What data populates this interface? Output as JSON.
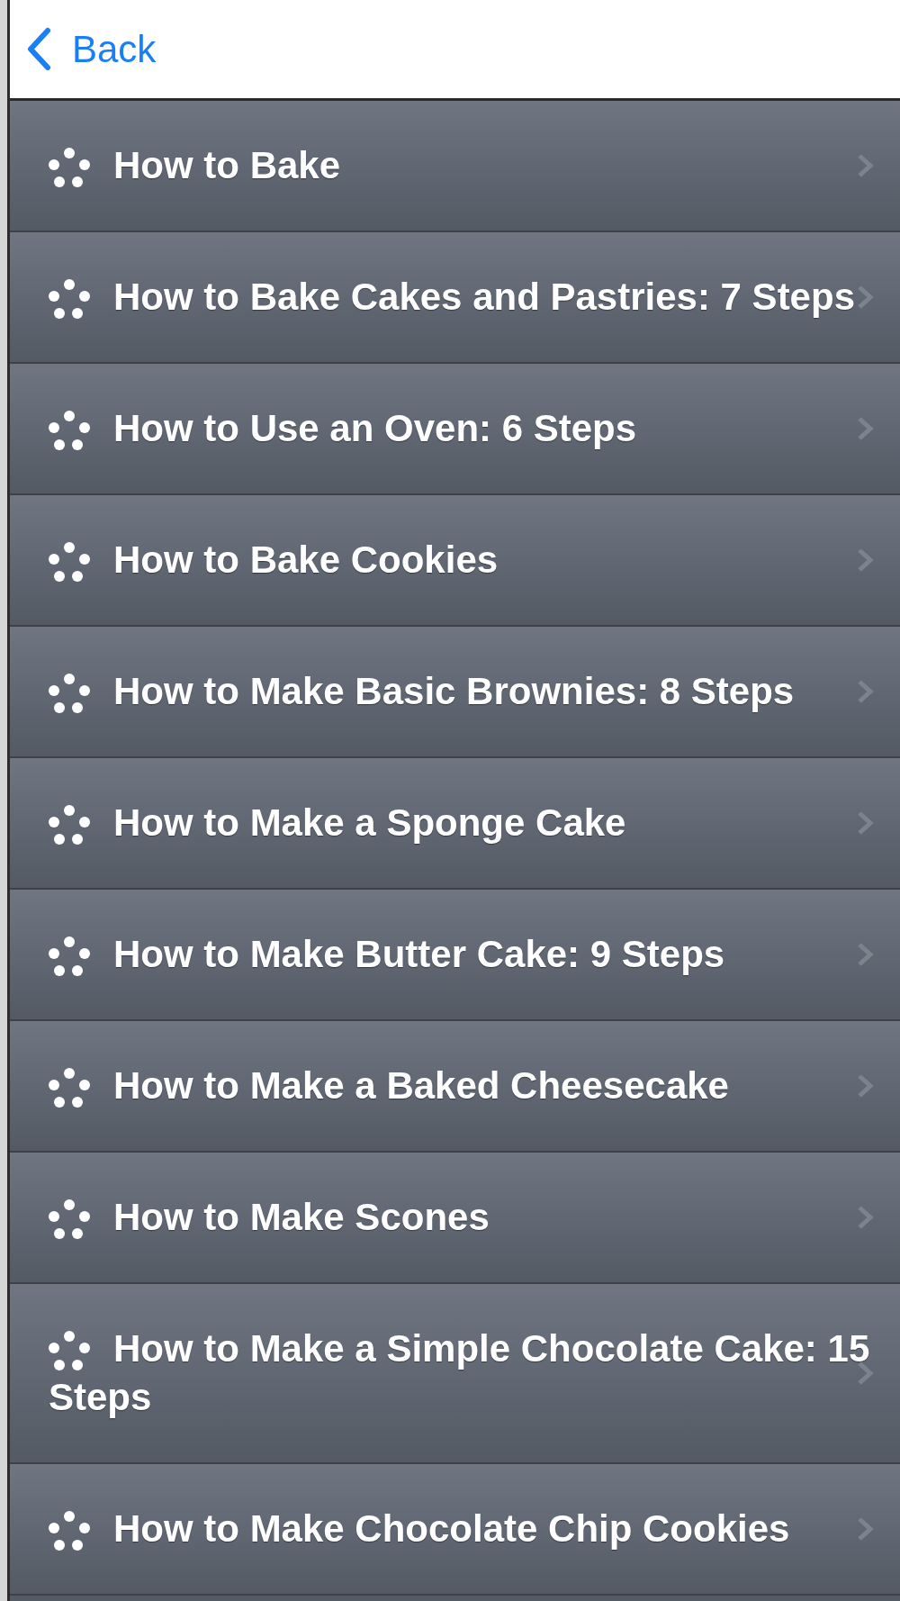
{
  "header": {
    "back_label": "Back"
  },
  "items": [
    {
      "title": "How to Bake"
    },
    {
      "title": "How to Bake Cakes and Pastries: 7 Steps"
    },
    {
      "title": "How to Use an Oven: 6 Steps"
    },
    {
      "title": "How to Bake Cookies"
    },
    {
      "title": "How to Make Basic Brownies: 8 Steps"
    },
    {
      "title": "How to Make a Sponge Cake"
    },
    {
      "title": "How to Make Butter Cake: 9 Steps"
    },
    {
      "title": "How to Make a Baked Cheesecake"
    },
    {
      "title": "How to Make Scones"
    },
    {
      "title": "How to Make a Simple Chocolate Cake: 15 Steps"
    },
    {
      "title": "How to Make Chocolate Chip Cookies"
    }
  ]
}
